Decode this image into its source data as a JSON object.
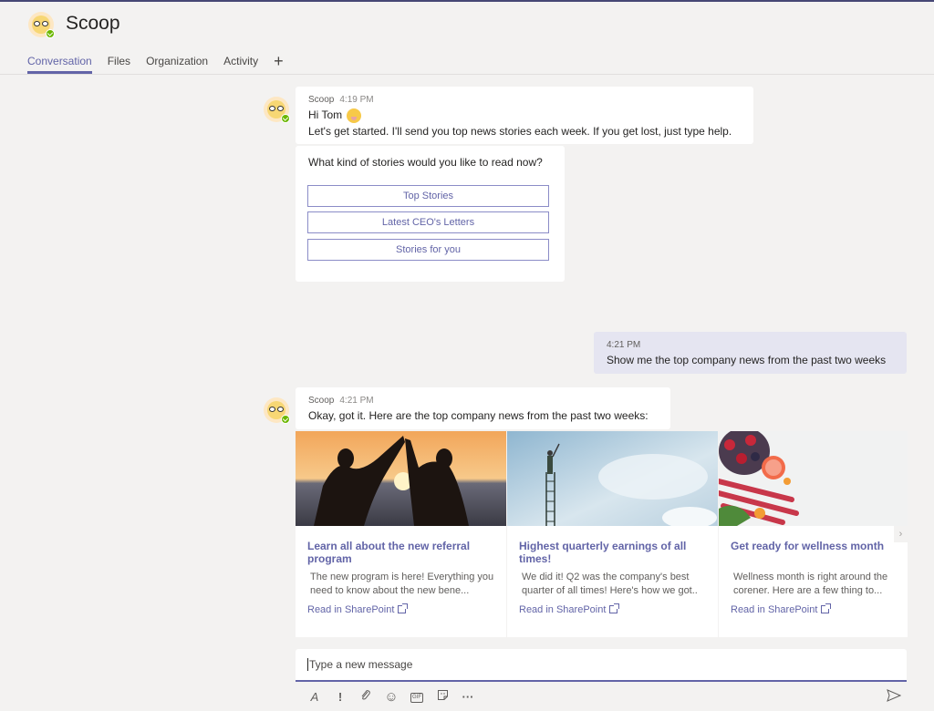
{
  "app": {
    "title": "Scoop",
    "tabs": [
      {
        "label": "Conversation",
        "active": true
      },
      {
        "label": "Files",
        "active": false
      },
      {
        "label": "Organization",
        "active": false
      },
      {
        "label": "Activity",
        "active": false
      }
    ],
    "add_tab_label": "+",
    "accent_color": "#6264a7",
    "status": "available"
  },
  "messages": {
    "m1": {
      "sender": "Scoop",
      "time": "4:19 PM",
      "greeting": "Hi Tom",
      "greeting_emoji": "tongue-face-emoji",
      "text": "Let's get started. I'll send you top news stories each week. If you get lost, just type help."
    },
    "m1_card": {
      "question": "What kind of stories would you like to read now?",
      "buttons": [
        "Top Stories",
        "Latest CEO's Letters",
        "Stories for you"
      ]
    },
    "m2": {
      "time": "4:21 PM",
      "text": "Show me the top company news from the past two weeks"
    },
    "m3": {
      "sender": "Scoop",
      "time": "4:21 PM",
      "text": "Okay, got it. Here are the top company news from the past two weeks:"
    }
  },
  "news_cards": [
    {
      "image": "high-five-sunset-photo",
      "title": "Learn all about the new referral program",
      "description": "The new program is here! Everything you need to know about the new bene...",
      "link": "Read in SharePoint"
    },
    {
      "image": "ladder-sky-photo",
      "title": "Highest quarterly earnings of all times!",
      "description": "We did it! Q2 was the company's best quarter of all times! Here's how we got..",
      "link": "Read in SharePoint"
    },
    {
      "image": "fruits-vegetables-photo",
      "title": "Get ready for wellness month",
      "description": "Wellness month is right around the corener. Here are a few thing to...",
      "link": "Read in SharePoint"
    }
  ],
  "carousel_next": "›",
  "compose": {
    "placeholder": "Type a new message",
    "tools": [
      "format-icon",
      "important-icon",
      "attach-icon",
      "emoji-icon",
      "gif-icon",
      "sticker-icon",
      "more-icon"
    ],
    "tool_glyphs": [
      "A",
      "!",
      "⌀",
      "☺",
      "GIF",
      "▢",
      "···"
    ]
  }
}
